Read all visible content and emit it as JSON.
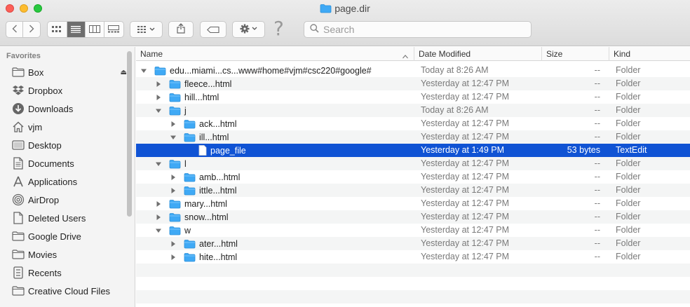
{
  "window": {
    "title": "page.dir"
  },
  "search": {
    "placeholder": "Search",
    "value": ""
  },
  "toolbar": {
    "icons": [
      "back-icon",
      "forward-icon",
      "icon-view-icon",
      "list-view-icon",
      "column-view-icon",
      "gallery-view-icon",
      "group-icon",
      "share-icon",
      "tag-icon",
      "action-gear-icon",
      "help-icon",
      "search-icon"
    ],
    "help_label": "?"
  },
  "sidebar": {
    "heading": "Favorites",
    "items": [
      {
        "label": "Box",
        "icon": "folder-icon"
      },
      {
        "label": "Dropbox",
        "icon": "dropbox-icon"
      },
      {
        "label": "Downloads",
        "icon": "download-icon"
      },
      {
        "label": "vjm",
        "icon": "home-icon"
      },
      {
        "label": "Desktop",
        "icon": "desktop-icon"
      },
      {
        "label": "Documents",
        "icon": "document-icon"
      },
      {
        "label": "Applications",
        "icon": "applications-icon"
      },
      {
        "label": "AirDrop",
        "icon": "airdrop-icon"
      },
      {
        "label": "Deleted Users",
        "icon": "document-icon"
      },
      {
        "label": "Google Drive",
        "icon": "folder-icon"
      },
      {
        "label": "Movies",
        "icon": "folder-icon"
      },
      {
        "label": "Recents",
        "icon": "recents-icon"
      },
      {
        "label": "Creative Cloud Files",
        "icon": "folder-icon"
      }
    ],
    "eject_label": "⏏"
  },
  "columns": {
    "name": "Name",
    "date": "Date Modified",
    "size": "Size",
    "kind": "Kind"
  },
  "rows": [
    {
      "name": "edu...miami...cs...www#home#vjm#csc220#google#",
      "date": "Today at 8:26 AM",
      "size": "--",
      "kind": "Folder",
      "level": 0,
      "expanded": true,
      "type": "folder"
    },
    {
      "name": "fleece...html",
      "date": "Yesterday at 12:47 PM",
      "size": "--",
      "kind": "Folder",
      "level": 1,
      "expanded": false,
      "type": "folder"
    },
    {
      "name": "hill...html",
      "date": "Yesterday at 12:47 PM",
      "size": "--",
      "kind": "Folder",
      "level": 1,
      "expanded": false,
      "type": "folder"
    },
    {
      "name": "j",
      "date": "Today at 8:26 AM",
      "size": "--",
      "kind": "Folder",
      "level": 1,
      "expanded": true,
      "type": "folder"
    },
    {
      "name": "ack...html",
      "date": "Yesterday at 12:47 PM",
      "size": "--",
      "kind": "Folder",
      "level": 2,
      "expanded": false,
      "type": "folder"
    },
    {
      "name": "ill...html",
      "date": "Yesterday at 12:47 PM",
      "size": "--",
      "kind": "Folder",
      "level": 2,
      "expanded": true,
      "type": "folder"
    },
    {
      "name": "page_file",
      "date": "Yesterday at 1:49 PM",
      "size": "53 bytes",
      "kind": "TextEdit",
      "level": 3,
      "expanded": null,
      "type": "file",
      "selected": true
    },
    {
      "name": "l",
      "date": "Yesterday at 12:47 PM",
      "size": "--",
      "kind": "Folder",
      "level": 1,
      "expanded": true,
      "type": "folder"
    },
    {
      "name": "amb...html",
      "date": "Yesterday at 12:47 PM",
      "size": "--",
      "kind": "Folder",
      "level": 2,
      "expanded": false,
      "type": "folder"
    },
    {
      "name": "ittle...html",
      "date": "Yesterday at 12:47 PM",
      "size": "--",
      "kind": "Folder",
      "level": 2,
      "expanded": false,
      "type": "folder"
    },
    {
      "name": "mary...html",
      "date": "Yesterday at 12:47 PM",
      "size": "--",
      "kind": "Folder",
      "level": 1,
      "expanded": false,
      "type": "folder"
    },
    {
      "name": "snow...html",
      "date": "Yesterday at 12:47 PM",
      "size": "--",
      "kind": "Folder",
      "level": 1,
      "expanded": false,
      "type": "folder"
    },
    {
      "name": "w",
      "date": "Yesterday at 12:47 PM",
      "size": "--",
      "kind": "Folder",
      "level": 1,
      "expanded": true,
      "type": "folder"
    },
    {
      "name": "ater...html",
      "date": "Yesterday at 12:47 PM",
      "size": "--",
      "kind": "Folder",
      "level": 2,
      "expanded": false,
      "type": "folder"
    },
    {
      "name": "hite...html",
      "date": "Yesterday at 12:47 PM",
      "size": "--",
      "kind": "Folder",
      "level": 2,
      "expanded": false,
      "type": "folder"
    }
  ],
  "colors": {
    "selection": "#1053d4",
    "folder": "#3fa9f5",
    "folder_dark": "#2b8fd8"
  }
}
